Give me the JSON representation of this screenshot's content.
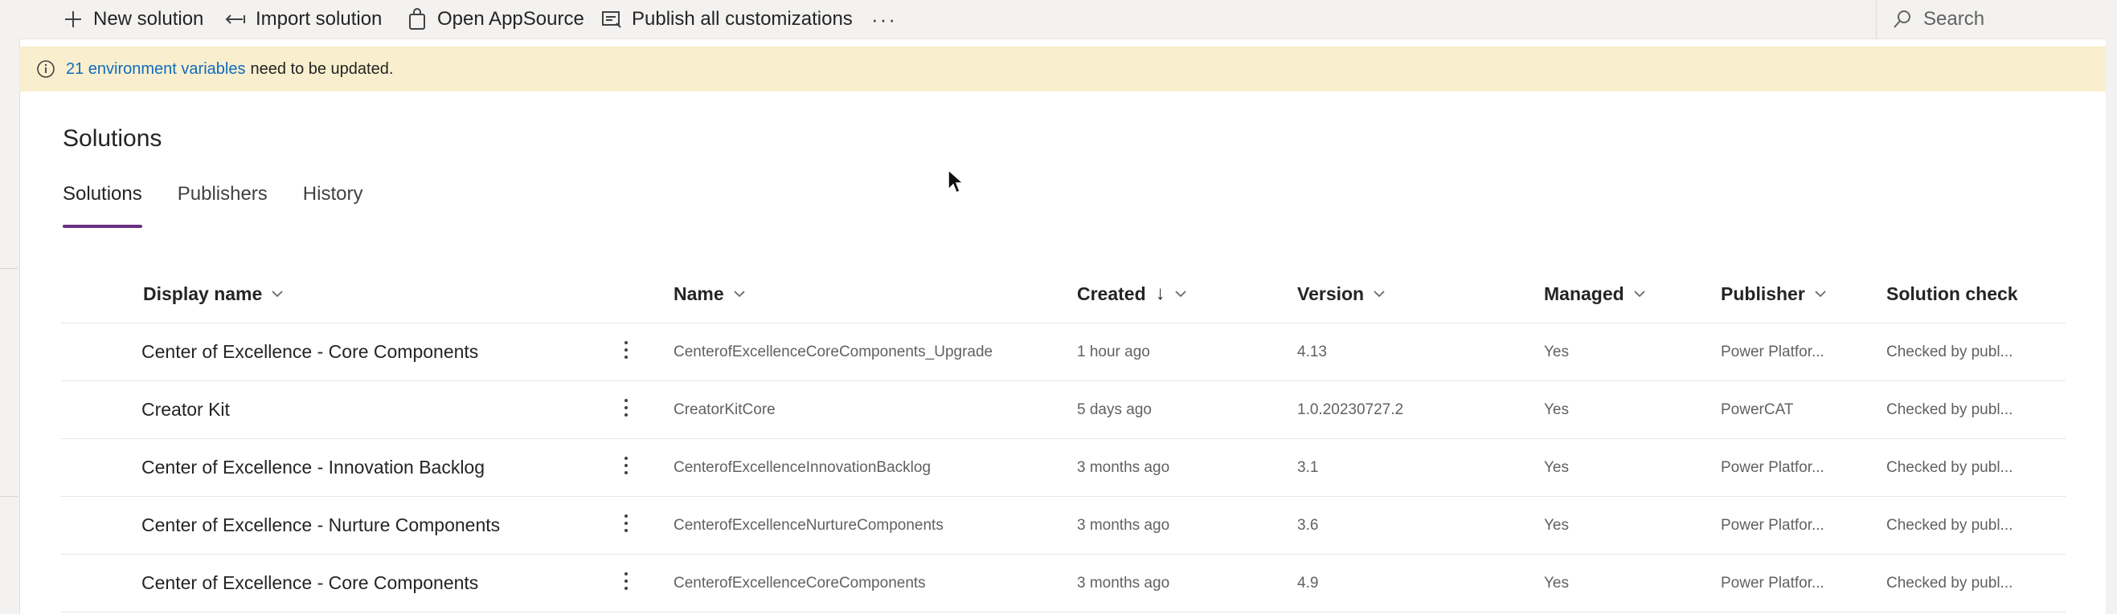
{
  "command_bar": {
    "new_solution": "New solution",
    "import_solution": "Import solution",
    "open_appsource": "Open AppSource",
    "publish_all": "Publish all customizations",
    "more": "···",
    "search_placeholder": "Search"
  },
  "banner": {
    "link_text": "21 environment variables",
    "message": "need to be updated."
  },
  "page_title": "Solutions",
  "tabs": [
    {
      "label": "Solutions",
      "active": true
    },
    {
      "label": "Publishers",
      "active": false
    },
    {
      "label": "History",
      "active": false
    }
  ],
  "columns": {
    "display_name": "Display name",
    "name": "Name",
    "created": "Created",
    "version": "Version",
    "managed": "Managed",
    "publisher": "Publisher",
    "solution_check": "Solution check"
  },
  "rows": [
    {
      "display_name": "Center of Excellence - Core Components",
      "name": "CenterofExcellenceCoreComponents_Upgrade",
      "created": "1 hour ago",
      "version": "4.13",
      "managed": "Yes",
      "publisher": "Power Platfor...",
      "solution_check": "Checked by publ..."
    },
    {
      "display_name": "Creator Kit",
      "name": "CreatorKitCore",
      "created": "5 days ago",
      "version": "1.0.20230727.2",
      "managed": "Yes",
      "publisher": "PowerCAT",
      "solution_check": "Checked by publ..."
    },
    {
      "display_name": "Center of Excellence - Innovation Backlog",
      "name": "CenterofExcellenceInnovationBacklog",
      "created": "3 months ago",
      "version": "3.1",
      "managed": "Yes",
      "publisher": "Power Platfor...",
      "solution_check": "Checked by publ..."
    },
    {
      "display_name": "Center of Excellence - Nurture Components",
      "name": "CenterofExcellenceNurtureComponents",
      "created": "3 months ago",
      "version": "3.6",
      "managed": "Yes",
      "publisher": "Power Platfor...",
      "solution_check": "Checked by publ..."
    },
    {
      "display_name": "Center of Excellence - Core Components",
      "name": "CenterofExcellenceCoreComponents",
      "created": "3 months ago",
      "version": "4.9",
      "managed": "Yes",
      "publisher": "Power Platfor...",
      "solution_check": "Checked by publ..."
    }
  ],
  "colors": {
    "accent": "#6b2f85",
    "banner_bg": "#f9efce",
    "link": "#0f6cbd"
  },
  "icons": {
    "new_solution": "plus-icon",
    "import_solution": "import-arrow-icon",
    "open_appsource": "shopping-bag-icon",
    "publish_all": "publish-icon",
    "search": "search-icon",
    "banner": "info-icon",
    "row_more": "vertical-ellipsis-icon"
  }
}
